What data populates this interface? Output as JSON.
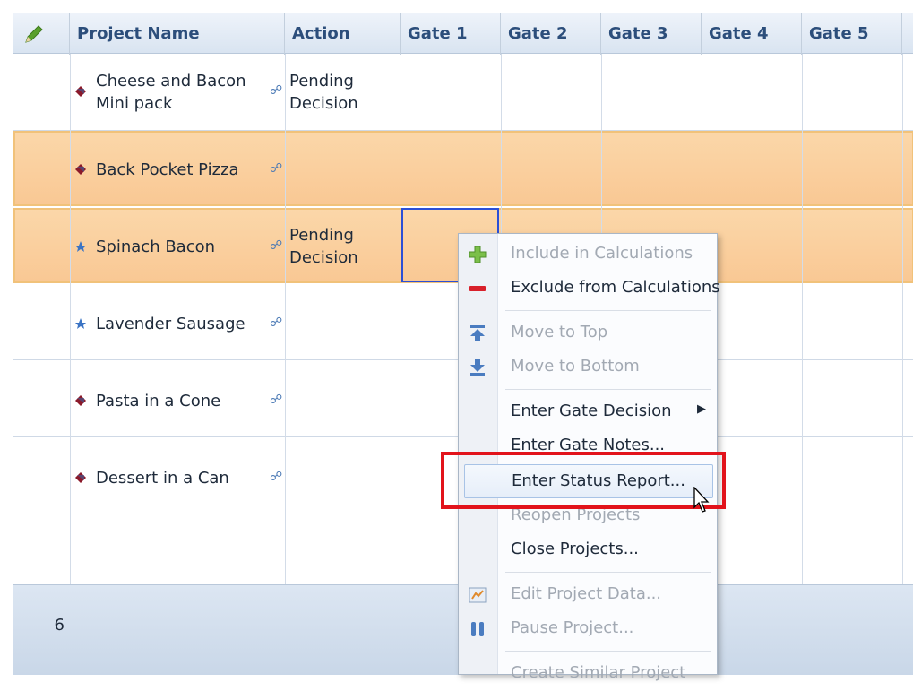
{
  "columns": {
    "edit_icon": "pencil-icon",
    "project_name": "Project Name",
    "action": "Action",
    "gate1": "Gate 1",
    "gate2": "Gate 2",
    "gate3": "Gate 3",
    "gate4": "Gate 4",
    "gate5": "Gate 5"
  },
  "rows": [
    {
      "name_line1": "Cheese and Bacon",
      "name_line2": "Mini pack",
      "action_line1": "Pending",
      "action_line2": "Decision",
      "icon": "red-diamond-icon",
      "selected": false
    },
    {
      "name_line1": "Back Pocket Pizza",
      "icon": "red-diamond-icon",
      "selected": true
    },
    {
      "name_line1": "Spinach Bacon",
      "action_line1": "Pending",
      "action_line2": "Decision",
      "icon": "blue-star-icon",
      "selected": true
    },
    {
      "name_line1": "Lavender Sausage",
      "icon": "blue-star-icon",
      "selected": false
    },
    {
      "name_line1": "Pasta in a Cone",
      "icon": "red-diamond-icon",
      "selected": false
    },
    {
      "name_line1": "Dessert in a Can",
      "icon": "red-diamond-icon",
      "selected": false
    }
  ],
  "footer": {
    "count": "6"
  },
  "context_menu": {
    "items": [
      {
        "label": "Include in Calculations",
        "disabled": true,
        "icon": "plus-icon"
      },
      {
        "label": "Exclude from Calculations",
        "disabled": false,
        "icon": "minus-icon"
      },
      {
        "label": "Move to Top",
        "disabled": true,
        "icon": "move-top-icon"
      },
      {
        "label": "Move to Bottom",
        "disabled": true,
        "icon": "move-bottom-icon"
      },
      {
        "label": "Enter Gate Decision",
        "disabled": false,
        "submenu": true
      },
      {
        "label": "Enter Gate Notes...",
        "disabled": false
      },
      {
        "label": "Enter Status Report...",
        "disabled": false,
        "highlighted": true
      },
      {
        "label": "Reopen Projects",
        "disabled": true
      },
      {
        "label": "Close Projects...",
        "disabled": false
      },
      {
        "label": "Edit Project Data...",
        "disabled": true,
        "icon": "edit-data-icon"
      },
      {
        "label": "Pause Project...",
        "disabled": true,
        "icon": "pause-icon"
      },
      {
        "label": "Create Similar Project",
        "disabled": true
      }
    ]
  },
  "colors": {
    "selected_row": "#f9c894",
    "highlight_box": "#e2131b",
    "header_text": "#2c4e7b",
    "cell_selection": "#2b4fd6"
  }
}
